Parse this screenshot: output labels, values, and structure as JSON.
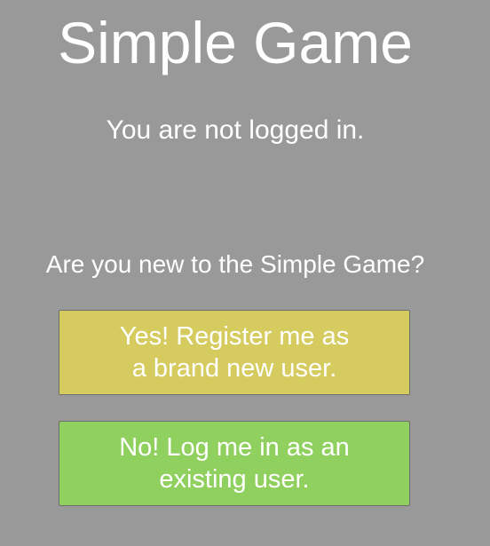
{
  "app": {
    "title": "Simple Game"
  },
  "status": {
    "text": "You are not logged in."
  },
  "prompt": {
    "question": "Are you new to the Simple Game?"
  },
  "buttons": {
    "register": {
      "line1": "Yes! Register me as",
      "line2": "a brand new user.",
      "color": "#d5cb5f"
    },
    "login": {
      "line1": "No! Log me in as an",
      "line2": "existing user.",
      "color": "#8fd05f"
    }
  },
  "colors": {
    "background": "#999999",
    "text": "#ffffff"
  }
}
